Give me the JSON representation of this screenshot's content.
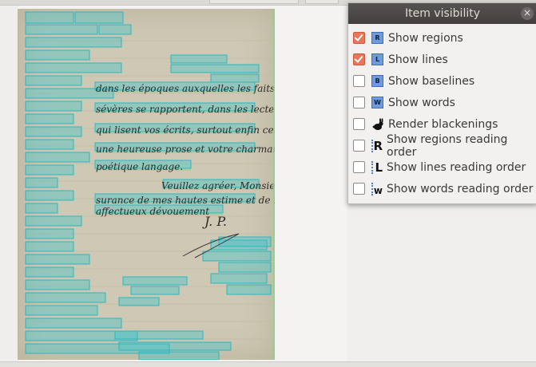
{
  "panel": {
    "title": "Item visibility",
    "close_glyph": "×",
    "options": [
      {
        "label": "Show regions",
        "checked": true,
        "icon": "R",
        "icon_name": "region-badge-icon"
      },
      {
        "label": "Show lines",
        "checked": true,
        "icon": "L",
        "icon_name": "line-badge-icon"
      },
      {
        "label": "Show baselines",
        "checked": false,
        "icon": "B",
        "icon_name": "baseline-badge-icon"
      },
      {
        "label": "Show words",
        "checked": false,
        "icon": "W",
        "icon_name": "word-badge-icon"
      },
      {
        "label": "Render blackenings",
        "checked": false,
        "icon": "",
        "icon_name": "rabbit-icon"
      },
      {
        "label": "Show regions reading order",
        "checked": false,
        "icon": "R",
        "icon_name": "regions-reading-order-icon"
      },
      {
        "label": "Show lines reading order",
        "checked": false,
        "icon": "L",
        "icon_name": "lines-reading-order-icon"
      },
      {
        "label": "Show words reading order",
        "checked": false,
        "icon": "w",
        "icon_name": "words-reading-order-icon"
      }
    ]
  },
  "document": {
    "handwriting": [
      "dans les époques auxquelles les faits",
      "sévères se rapportent, dans les lecteurs",
      "qui lisent vos écrits, surtout enfin cette",
      "une heureuse prose et votre charmant et",
      "poétique langage.",
      "Veuillez agréer, Monsieur, l'as-",
      "surance de mes hautes estime et de mon",
      "affectueux dévouement",
      "J. P."
    ]
  },
  "colors": {
    "overlay": "#35c4cc",
    "checkbox_checked": "#e8765a",
    "badge": "#6e9bdb",
    "title_bar": "#4a4745"
  }
}
